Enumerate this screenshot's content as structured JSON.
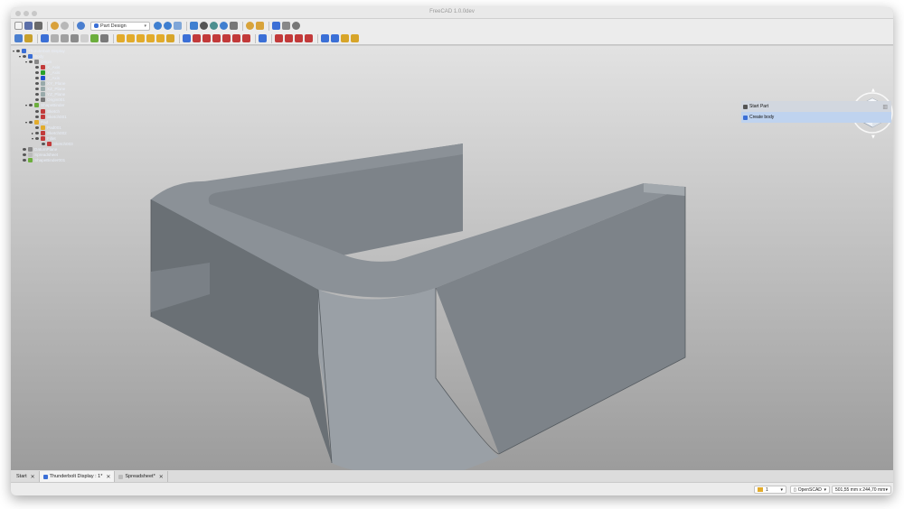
{
  "window": {
    "title": "FreeCAD 1.0.0dev"
  },
  "toolbar": {
    "workbench": "Part Design"
  },
  "tree": {
    "items": [
      {
        "label": "Thunderbolt Display",
        "depth": 0,
        "arrow": "▾"
      },
      {
        "label": "Body",
        "depth": 1,
        "arrow": "▾"
      },
      {
        "label": "Origin",
        "depth": 2,
        "arrow": "▾"
      },
      {
        "label": "X_Axis",
        "depth": 3,
        "arrow": ""
      },
      {
        "label": "Y_Axis",
        "depth": 3,
        "arrow": ""
      },
      {
        "label": "Z_Axis",
        "depth": 3,
        "arrow": ""
      },
      {
        "label": "XY_Plane",
        "depth": 3,
        "arrow": ""
      },
      {
        "label": "XZ_Plane",
        "depth": 3,
        "arrow": ""
      },
      {
        "label": "YZ_Plane",
        "depth": 3,
        "arrow": ""
      },
      {
        "label": "Origin001",
        "depth": 3,
        "arrow": ""
      },
      {
        "label": "ShapeBinder",
        "depth": 2,
        "arrow": "▾"
      },
      {
        "label": "Sketch",
        "depth": 3,
        "arrow": ""
      },
      {
        "label": "Sketch001",
        "depth": 3,
        "arrow": ""
      },
      {
        "label": "Pad",
        "depth": 2,
        "arrow": "▾"
      },
      {
        "label": "Pad001",
        "depth": 3,
        "arrow": ""
      },
      {
        "label": "Sketch002",
        "depth": 3,
        "arrow": "▸"
      },
      {
        "label": "Fillet",
        "depth": 3,
        "arrow": "▾"
      },
      {
        "label": "Sketch003",
        "depth": 4,
        "arrow": ""
      },
      {
        "label": "DatumPlane",
        "depth": 1,
        "arrow": ""
      },
      {
        "label": "Spreadsheet",
        "depth": 1,
        "arrow": ""
      },
      {
        "label": "ShapeBinder001",
        "depth": 1,
        "arrow": ""
      }
    ]
  },
  "tasks": {
    "start_part": "Start Part",
    "create_body": "Create body"
  },
  "tabs": [
    {
      "label": "Start",
      "active": false
    },
    {
      "label": "Thunderbolt Display : 1*",
      "active": true
    },
    {
      "label": "Spreadsheet*",
      "active": false
    }
  ],
  "status": {
    "page": "1",
    "navigation": "OpenSCAD",
    "dimensions": "501,55 mm x 244,70 mm"
  },
  "colors": {
    "accent": "#3b6fd6",
    "model_face": "#7e858c",
    "background_top": "#e2e2e2",
    "background_bottom": "#9c9c9c"
  }
}
